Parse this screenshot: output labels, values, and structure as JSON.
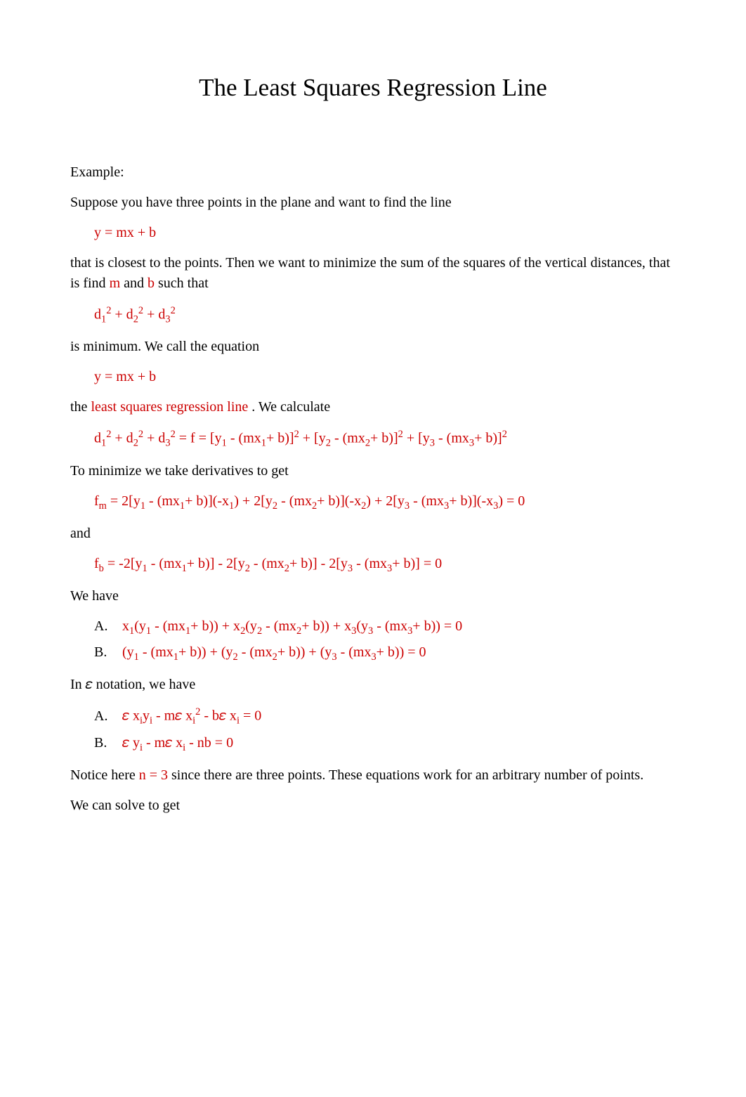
{
  "title": "The Least Squares Regression Line",
  "p_example": "Example:",
  "p_suppose": "Suppose you have three points in the plane and want to find the line",
  "eq_line1": "y = mx + b",
  "p_closest_pre": "that is closest to the points. Then we want to minimize the sum of the squares of the vertical distances, that is find ",
  "m": "m",
  "p_closest_mid": " and ",
  "b": "b",
  "p_closest_post": " such that",
  "p_ismin": "is minimum. We call the equation",
  "eq_line2": "y = mx + b",
  "p_the": "the ",
  "term_lsrl": "least squares regression line",
  "p_wecalc": " . We calculate",
  "eq_fdef_html": "d<sub>1</sub><sup>2</sup> + d<sub>2</sub><sup>2</sup> + d<sub>3</sub><sup>2</sup>  = f = [y<sub>1</sub> - (mx<sub>1</sub>+ b)]<sup>2</sup> + [y<sub>2</sub> - (mx<sub>2</sub>+ b)]<sup>2</sup> + [y<sub>3</sub> - (mx<sub>3</sub>+ b)]<sup>2</sup>",
  "eq_d1d2d3_html": "d<sub>1</sub><sup>2</sup> + d<sub>2</sub><sup>2</sup> + d<sub>3</sub><sup>2</sup>",
  "p_tomin": "To minimize we take derivatives to get",
  "eq_fm_html": "f<sub>m</sub> = 2[y<sub>1</sub> - (mx<sub>1</sub>+ b)](-x<sub>1</sub>) + 2[y<sub>2</sub> - (mx<sub>2</sub>+ b)](-x<sub>2</sub>) + 2[y<sub>3</sub> - (mx<sub>3</sub>+ b)](-x<sub>3</sub>) = 0",
  "p_and": "and",
  "eq_fb_html": "f<sub>b</sub> = -2[y<sub>1</sub> - (mx<sub>1</sub>+ b)] - 2[y<sub>2</sub> - (mx<sub>2</sub>+ b)] - 2[y<sub>3</sub> - (mx<sub>3</sub>+ b)] = 0",
  "p_wehave": "We have",
  "list1": {
    "A_label": "A.",
    "A_html": "x<sub>1</sub>(y<sub>1</sub> - (mx<sub>1</sub>+ b)) + x<sub>2</sub>(y<sub>2</sub> - (mx<sub>2</sub>+ b)) + x<sub>3</sub>(y<sub>3</sub> - (mx<sub>3</sub>+ b)) = 0",
    "B_label": "B.",
    "B_html": "(y<sub>1</sub> - (mx<sub>1</sub>+ b)) + (y<sub>2</sub> - (mx<sub>2</sub>+ b)) + (y<sub>3</sub> - (mx<sub>3</sub>+ b)) = 0"
  },
  "p_insigma_pre": "In ",
  "sigma": "𝜀",
  "p_insigma_post": "  notation, we have",
  "list2": {
    "A_label": "A.",
    "A_html": "𝜀 x<sub>i</sub>y<sub>i</sub> - m𝜀 x<sub>i</sub><sup>2</sup> - b𝜀 x<sub>i</sub> = 0",
    "B_label": "B.",
    "B_html": "𝜀 y<sub>i</sub> - m𝜀 x<sub>i</sub> - nb = 0"
  },
  "p_notice_pre": "Notice here ",
  "n3": "n = 3",
  "p_notice_post": " since there are three points. These equations work for an arbitrary number of points.",
  "p_solve": "We can solve to get"
}
